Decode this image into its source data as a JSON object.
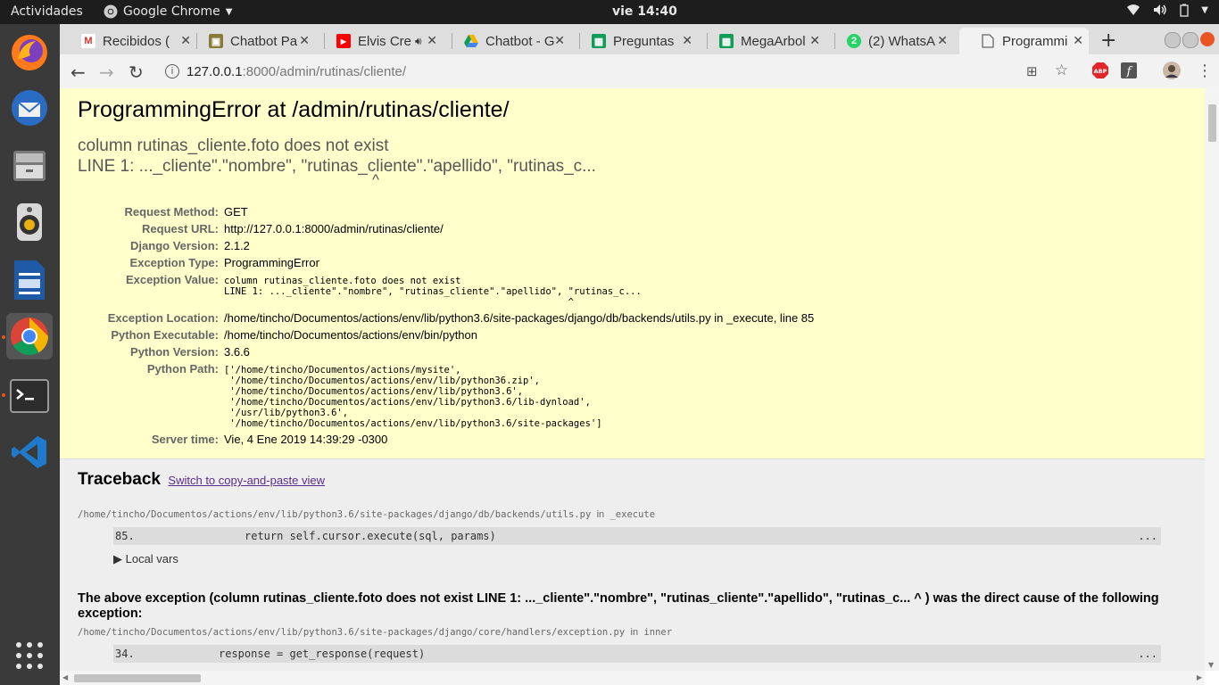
{
  "topbar": {
    "activities": "Actividades",
    "app": "Google Chrome",
    "clock": "vie 14:40"
  },
  "dock": {
    "items": [
      {
        "name": "firefox-icon"
      },
      {
        "name": "thunderbird-icon"
      },
      {
        "name": "files-icon"
      },
      {
        "name": "rhythmbox-icon"
      },
      {
        "name": "libreoffice-writer-icon"
      },
      {
        "name": "chrome-icon"
      },
      {
        "name": "terminal-icon"
      },
      {
        "name": "vscode-icon"
      }
    ],
    "show_apps": "show-applications-icon"
  },
  "tabs": [
    {
      "label": "Recibidos (",
      "icon": "gmail-icon",
      "color": "#d93025"
    },
    {
      "label": "Chatbot Pa",
      "icon": "page-icon",
      "color": "#8a7a3a"
    },
    {
      "label": "Elvis Cre",
      "icon": "youtube-icon",
      "color": "#ff0000"
    },
    {
      "label": "Chatbot - G",
      "icon": "drive-icon",
      "color": "#1fa463"
    },
    {
      "label": "Preguntas",
      "icon": "sheets-icon",
      "color": "#0f9d58"
    },
    {
      "label": "MegaArbol",
      "icon": "sheets-icon",
      "color": "#0f9d58"
    },
    {
      "label": "(2) WhatsA",
      "icon": "whatsapp-icon",
      "color": "#25d366"
    },
    {
      "label": "Programmi",
      "icon": "document-icon",
      "color": "#777777"
    }
  ],
  "url": {
    "host": "127.0.0.1",
    "path": ":8000/admin/rutinas/cliente/"
  },
  "error": {
    "title": "ProgrammingError at /admin/rutinas/cliente/",
    "value_line1": "column rutinas_cliente.foto does not exist",
    "value_line2": "LINE 1: ..._cliente\".\"nombre\", \"rutinas_cliente\".\"apellido\", \"rutinas_c...",
    "caret": "^"
  },
  "meta": {
    "request_method_label": "Request Method:",
    "request_method": "GET",
    "request_url_label": "Request URL:",
    "request_url": "http://127.0.0.1:8000/admin/rutinas/cliente/",
    "django_version_label": "Django Version:",
    "django_version": "2.1.2",
    "exception_type_label": "Exception Type:",
    "exception_type": "ProgrammingError",
    "exception_value_label": "Exception Value:",
    "exception_value": "column rutinas_cliente.foto does not exist\nLINE 1: ..._cliente\".\"nombre\", \"rutinas_cliente\".\"apellido\", \"rutinas_c...\n                                                             ^",
    "exception_location_label": "Exception Location:",
    "exception_location": "/home/tincho/Documentos/actions/env/lib/python3.6/site-packages/django/db/backends/utils.py in _execute, line 85",
    "python_executable_label": "Python Executable:",
    "python_executable": "/home/tincho/Documentos/actions/env/bin/python",
    "python_version_label": "Python Version:",
    "python_version": "3.6.6",
    "python_path_label": "Python Path:",
    "python_path": "['/home/tincho/Documentos/actions/mysite',\n '/home/tincho/Documentos/actions/env/lib/python36.zip',\n '/home/tincho/Documentos/actions/env/lib/python3.6',\n '/home/tincho/Documentos/actions/env/lib/python3.6/lib-dynload',\n '/usr/lib/python3.6',\n '/home/tincho/Documentos/actions/env/lib/python3.6/site-packages']",
    "server_time_label": "Server time:",
    "server_time": "Vie, 4 Ene 2019 14:39:29 -0300"
  },
  "traceback": {
    "heading": "Traceback",
    "switch_link": "Switch to copy-and-paste view",
    "frame1_file": "/home/tincho/Documentos/actions/env/lib/python3.6/site-packages/django/db/backends/utils.py",
    "frame1_in": "in",
    "frame1_func": "_execute",
    "frame1_lineno": "85.",
    "frame1_code": "return self.cursor.execute(sql, params)",
    "ellipsis": "...",
    "local_vars": "▶ Local vars",
    "cause_text": "The above exception (column rutinas_cliente.foto does not exist LINE 1: ..._cliente\".\"nombre\", \"rutinas_cliente\".\"apellido\", \"rutinas_c... ^ ) was the direct cause of the following exception:",
    "frame2_file": "/home/tincho/Documentos/actions/env/lib/python3.6/site-packages/django/core/handlers/exception.py",
    "frame2_in": "in",
    "frame2_func": "inner",
    "frame2_lineno": "34.",
    "frame2_code": "response = get_response(request)"
  }
}
